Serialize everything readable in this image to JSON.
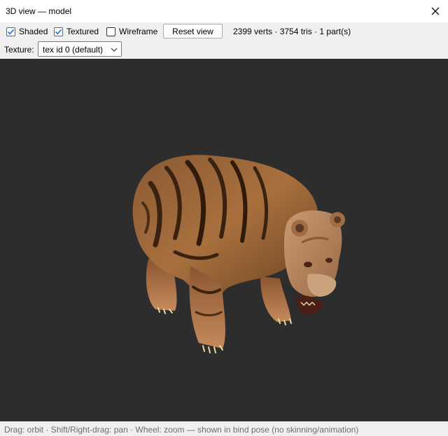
{
  "window": {
    "title": "3D view — model"
  },
  "toolbar": {
    "shaded": {
      "label": "Shaded",
      "checked": true
    },
    "textured": {
      "label": "Textured",
      "checked": true
    },
    "wireframe": {
      "label": "Wireframe",
      "checked": false
    },
    "reset_label": "Reset view",
    "stats": "2399 verts · 3754 tris · 1 part(s)"
  },
  "texture": {
    "label": "Texture:",
    "selected": "tex id 0 (default)"
  },
  "viewport": {
    "background": "#2d2d2d",
    "model_subject": "textured brown bear model"
  },
  "status": {
    "hint": "Drag: orbit · Shift/Right-drag: pan · Wheel: zoom — shown in bind pose (no skinning/animation)"
  },
  "icons": {
    "close": "close-icon",
    "check": "check-icon",
    "dropdown": "chevron-down-icon"
  },
  "colors": {
    "accent": "#1a73d9",
    "viewport_bg": "#2d2d2d"
  }
}
